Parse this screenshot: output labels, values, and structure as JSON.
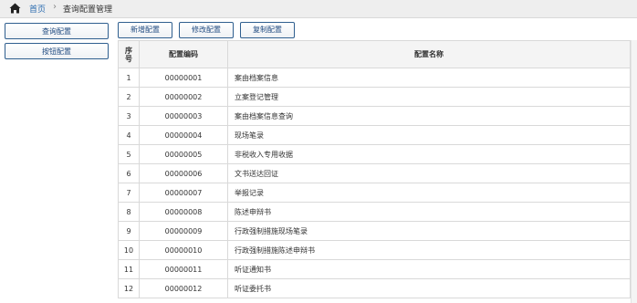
{
  "breadcrumb": {
    "home": "首页",
    "separator": "›",
    "current": "查询配置管理"
  },
  "left_menu": [
    {
      "label": "查询配置"
    },
    {
      "label": "按钮配置"
    }
  ],
  "toolbar": {
    "add": "新增配置",
    "edit": "修改配置",
    "copy": "复制配置"
  },
  "table": {
    "headers": {
      "index": "序号",
      "code": "配置编码",
      "name": "配置名称"
    },
    "rows": [
      {
        "index": "1",
        "code": "00000001",
        "name": "案由档案信息"
      },
      {
        "index": "2",
        "code": "00000002",
        "name": "立案登记管理"
      },
      {
        "index": "3",
        "code": "00000003",
        "name": "案由档案信息查询"
      },
      {
        "index": "4",
        "code": "00000004",
        "name": "现场笔录"
      },
      {
        "index": "5",
        "code": "00000005",
        "name": "非税收入专用收据"
      },
      {
        "index": "6",
        "code": "00000006",
        "name": "文书送达回证"
      },
      {
        "index": "7",
        "code": "00000007",
        "name": "举报记录"
      },
      {
        "index": "8",
        "code": "00000008",
        "name": "陈述申辩书"
      },
      {
        "index": "9",
        "code": "00000009",
        "name": "行政强制措施现场笔录"
      },
      {
        "index": "10",
        "code": "00000010",
        "name": "行政强制措施陈述申辩书"
      },
      {
        "index": "11",
        "code": "00000011",
        "name": "听证通知书"
      },
      {
        "index": "12",
        "code": "00000012",
        "name": "听证委托书"
      }
    ]
  },
  "colors": {
    "accent": "#2f5f8f",
    "link": "#2b6cb0",
    "header_bg": "#f4f4f4"
  }
}
